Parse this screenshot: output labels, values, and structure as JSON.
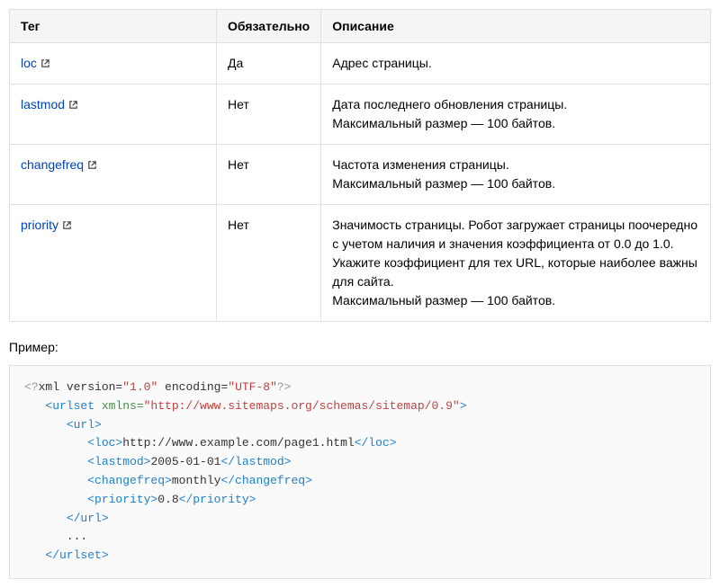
{
  "table": {
    "headers": {
      "tag": "Тег",
      "required": "Обязательно",
      "description": "Описание"
    },
    "rows": [
      {
        "tag": "loc",
        "required": "Да",
        "description": "Адрес страницы."
      },
      {
        "tag": "lastmod",
        "required": "Нет",
        "description": "Дата последнего обновления страницы.\nМаксимальный размер — 100 байтов."
      },
      {
        "tag": "changefreq",
        "required": "Нет",
        "description": "Частота изменения страницы.\nМаксимальный размер — 100 байтов."
      },
      {
        "tag": "priority",
        "required": "Нет",
        "description": "Значимость страницы. Робот загружает страницы поочередно с учетом наличия и значения коэффициента от 0.0 до 1.0. Укажите коэффициент для тех URL, которые наиболее важны для сайта.\nМаксимальный размер — 100 байтов."
      }
    ]
  },
  "example_label": "Пример:",
  "code": {
    "tokens": [
      [
        [
          "gray",
          "<?"
        ],
        [
          "default",
          "xml version="
        ],
        [
          "str",
          "\"1.0\""
        ],
        [
          "default",
          " encoding="
        ],
        [
          "str",
          "\"UTF-8\""
        ],
        [
          "gray",
          "?>"
        ]
      ],
      [
        [
          "default",
          "   "
        ],
        [
          "tag",
          "<urlset"
        ],
        [
          "attr",
          " xmlns="
        ],
        [
          "str",
          "\"http://www.sitemaps.org/schemas/sitemap/0.9\""
        ],
        [
          "tag",
          ">"
        ]
      ],
      [
        [
          "default",
          "      "
        ],
        [
          "tag",
          "<url>"
        ]
      ],
      [
        [
          "default",
          "         "
        ],
        [
          "tag",
          "<loc>"
        ],
        [
          "text",
          "http://www.example.com/page1.html"
        ],
        [
          "tag",
          "</loc>"
        ]
      ],
      [
        [
          "default",
          "         "
        ],
        [
          "tag",
          "<lastmod>"
        ],
        [
          "text",
          "2005-01-01"
        ],
        [
          "tag",
          "</lastmod>"
        ]
      ],
      [
        [
          "default",
          "         "
        ],
        [
          "tag",
          "<changefreq>"
        ],
        [
          "text",
          "monthly"
        ],
        [
          "tag",
          "</changefreq>"
        ]
      ],
      [
        [
          "default",
          "         "
        ],
        [
          "tag",
          "<priority>"
        ],
        [
          "text",
          "0.8"
        ],
        [
          "tag",
          "</priority>"
        ]
      ],
      [
        [
          "default",
          "      "
        ],
        [
          "tag",
          "</url>"
        ]
      ],
      [
        [
          "default",
          "      "
        ],
        [
          "text",
          "..."
        ]
      ],
      [
        [
          "default",
          "   "
        ],
        [
          "tag",
          "</urlset>"
        ]
      ]
    ]
  }
}
